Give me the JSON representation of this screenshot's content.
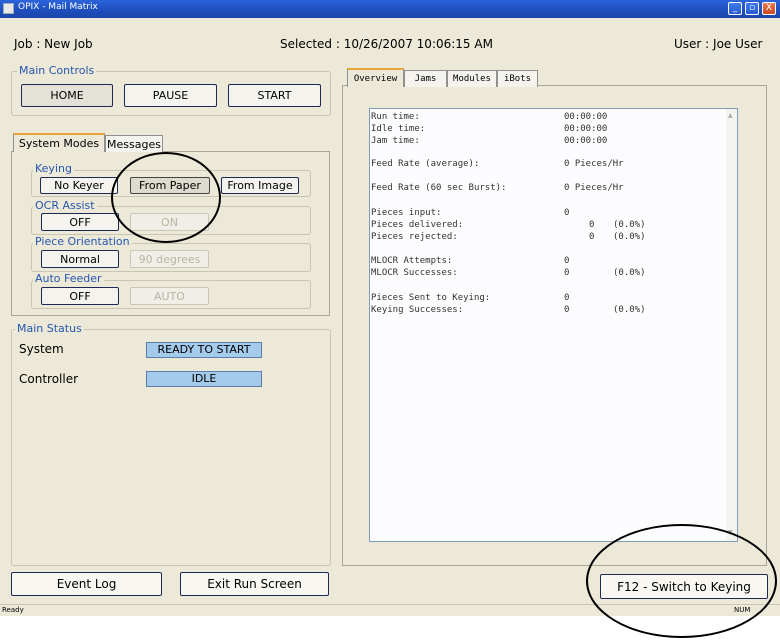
{
  "window": {
    "title": "OPIX - Mail Matrix",
    "controls": {
      "minimize": "_",
      "restore": "▫",
      "close": "X"
    }
  },
  "header": {
    "job": "Job : New Job",
    "selected": "Selected : 10/26/2007 10:06:15 AM",
    "user": "User : Joe User"
  },
  "main_controls": {
    "title": "Main Controls",
    "home": "HOME",
    "pause": "PAUSE",
    "start": "START"
  },
  "left_tabs": {
    "system_modes": "System Modes",
    "messages": "Messages"
  },
  "keying": {
    "title": "Keying",
    "no_keyer": "No Keyer",
    "from_paper": "From Paper",
    "from_image": "From Image"
  },
  "ocr_assist": {
    "title": "OCR Assist",
    "off": "OFF",
    "on": "ON"
  },
  "piece_orientation": {
    "title": "Piece Orientation",
    "normal": "Normal",
    "degrees": "90 degrees"
  },
  "auto_feeder": {
    "title": "Auto Feeder",
    "off": "OFF",
    "auto": "AUTO"
  },
  "main_status": {
    "title": "Main Status",
    "system_label": "System",
    "system_value": "READY TO START",
    "controller_label": "Controller",
    "controller_value": "IDLE"
  },
  "right_tabs": {
    "overview": "Overview",
    "jams": "Jams",
    "modules": "Modules",
    "ibots": "iBots"
  },
  "overview": {
    "run_time_label": "Run time:",
    "run_time": "00:00:00",
    "idle_time_label": "Idle time:",
    "idle_time": "00:00:00",
    "jam_time_label": "Jam time:",
    "jam_time": "00:00:00",
    "feed_rate_avg_label": "Feed Rate (average):",
    "feed_rate_avg": "0 Pieces/Hr",
    "feed_rate_burst_label": "Feed Rate (60 sec Burst):",
    "feed_rate_burst": "0 Pieces/Hr",
    "pieces_input_label": "Pieces input:",
    "pieces_input": "0",
    "pieces_delivered_label": "Pieces delivered:",
    "pieces_delivered": "0",
    "pieces_delivered_pct": "(0.0%)",
    "pieces_rejected_label": "Pieces rejected:",
    "pieces_rejected": "0",
    "pieces_rejected_pct": "(0.0%)",
    "mlocr_attempts_label": "MLOCR Attempts:",
    "mlocr_attempts": "0",
    "mlocr_successes_label": "MLOCR Successes:",
    "mlocr_successes": "0",
    "mlocr_successes_pct": "(0.0%)",
    "sent_keying_label": "Pieces Sent to Keying:",
    "sent_keying": "0",
    "keying_successes_label": "Keying Successes:",
    "keying_successes": "0",
    "keying_successes_pct": "(0.0%)"
  },
  "bottom": {
    "event_log": "Event Log",
    "exit_run": "Exit Run Screen",
    "switch_keying": "F12 - Switch to Keying"
  },
  "statusbar": {
    "left": "Ready",
    "right": "NUM"
  }
}
